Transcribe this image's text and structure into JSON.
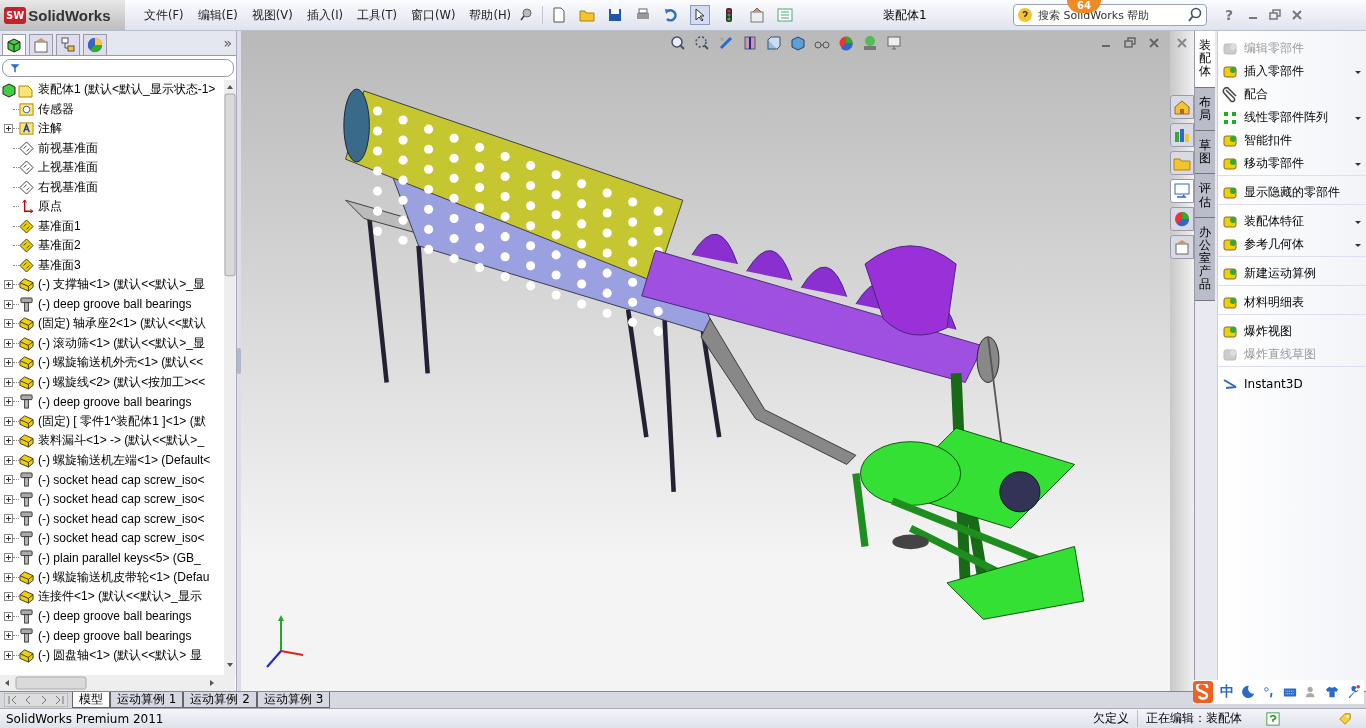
{
  "app": {
    "logo_mark": "SW",
    "logo_text": "SolidWorks"
  },
  "menu": [
    "文件(F)",
    "编辑(E)",
    "视图(V)",
    "插入(I)",
    "工具(T)",
    "窗口(W)",
    "帮助(H)"
  ],
  "window": {
    "title": "装配体1"
  },
  "search": {
    "placeholder": "搜索 SolidWorks 帮助",
    "badge": "64"
  },
  "help_button": "?",
  "panel_expand": "»",
  "tree": {
    "label": "装配体1  (默认<默认_显示状态-1>",
    "kind": "assembly",
    "children": [
      {
        "label": "传感器",
        "kind": "sensor",
        "expander": false
      },
      {
        "label": "注解",
        "kind": "annotation",
        "expander": true
      },
      {
        "label": "前视基准面",
        "kind": "plane",
        "expander": false
      },
      {
        "label": "上视基准面",
        "kind": "plane",
        "expander": false
      },
      {
        "label": "右视基准面",
        "kind": "plane",
        "expander": false
      },
      {
        "label": "原点",
        "kind": "origin",
        "expander": false
      },
      {
        "label": "基准面1",
        "kind": "ref-plane",
        "expander": false
      },
      {
        "label": "基准面2",
        "kind": "ref-plane",
        "expander": false
      },
      {
        "label": "基准面3",
        "kind": "ref-plane",
        "expander": false
      },
      {
        "label": "(-) 支撑轴<1> (默认<<默认>_显",
        "kind": "part",
        "expander": true
      },
      {
        "label": "(-) deep groove ball bearings",
        "kind": "fastener",
        "expander": true
      },
      {
        "label": "(固定) 轴承座2<1> (默认<<默认",
        "kind": "part",
        "expander": true
      },
      {
        "label": "(-) 滚动筛<1> (默认<<默认>_显",
        "kind": "part",
        "expander": true
      },
      {
        "label": "(-) 螺旋输送机外壳<1> (默认<<",
        "kind": "part",
        "expander": true
      },
      {
        "label": "(-) 螺旋线<2> (默认<按加工><<",
        "kind": "part",
        "expander": true
      },
      {
        "label": "(-) deep groove ball bearings",
        "kind": "fastener",
        "expander": true
      },
      {
        "label": "(固定) [ 零件1^装配体1 ]<1> (默",
        "kind": "part",
        "expander": true
      },
      {
        "label": "装料漏斗<1> -> (默认<<默认>_",
        "kind": "part",
        "expander": true
      },
      {
        "label": "(-) 螺旋输送机左端<1> (Default<",
        "kind": "part",
        "expander": true
      },
      {
        "label": "(-) socket head cap screw_iso<",
        "kind": "fastener",
        "expander": true
      },
      {
        "label": "(-) socket head cap screw_iso<",
        "kind": "fastener",
        "expander": true
      },
      {
        "label": "(-) socket head cap screw_iso<",
        "kind": "fastener",
        "expander": true
      },
      {
        "label": "(-) socket head cap screw_iso<",
        "kind": "fastener",
        "expander": true
      },
      {
        "label": "(-) plain parallel keys<5> (GB_",
        "kind": "fastener",
        "expander": true
      },
      {
        "label": "(-) 螺旋输送机皮带轮<1> (Defau",
        "kind": "part",
        "expander": true
      },
      {
        "label": "连接件<1> (默认<<默认>_显示",
        "kind": "part",
        "expander": true
      },
      {
        "label": "(-) deep groove ball bearings",
        "kind": "fastener",
        "expander": true
      },
      {
        "label": "(-) deep groove ball bearings",
        "kind": "fastener",
        "expander": true
      },
      {
        "label": "(-) 圆盘轴<1> (默认<<默认> 显",
        "kind": "part",
        "expander": true
      }
    ]
  },
  "bottom_tabs": [
    {
      "label": "模型",
      "selected": true
    },
    {
      "label": "运动算例 1",
      "selected": false
    },
    {
      "label": "运动算例 2",
      "selected": false
    },
    {
      "label": "运动算例 3",
      "selected": false
    }
  ],
  "task_tabs": [
    {
      "label": "装配体",
      "selected": true
    },
    {
      "label": "布局",
      "selected": false
    },
    {
      "label": "草图",
      "selected": false
    },
    {
      "label": "评估",
      "selected": false
    },
    {
      "label": "办公室产品",
      "selected": false
    }
  ],
  "commands": [
    {
      "label": "编辑零部件",
      "kind": "edit-component",
      "disabled": true,
      "dropdown": false,
      "divider": false
    },
    {
      "label": "插入零部件",
      "kind": "insert",
      "disabled": false,
      "dropdown": true,
      "divider": false
    },
    {
      "label": "配合",
      "kind": "mate",
      "disabled": false,
      "dropdown": false,
      "divider": false
    },
    {
      "label": "线性零部件阵列",
      "kind": "pattern",
      "disabled": false,
      "dropdown": true,
      "divider": false
    },
    {
      "label": "智能扣件",
      "kind": "fastener",
      "disabled": false,
      "dropdown": false,
      "divider": false
    },
    {
      "label": "移动零部件",
      "kind": "move",
      "disabled": false,
      "dropdown": true,
      "divider": true
    },
    {
      "label": "显示隐藏的零部件",
      "kind": "show-hidden",
      "disabled": false,
      "dropdown": false,
      "divider": true
    },
    {
      "label": "装配体特征",
      "kind": "feature",
      "disabled": false,
      "dropdown": true,
      "divider": false
    },
    {
      "label": "参考几何体",
      "kind": "reference",
      "disabled": false,
      "dropdown": true,
      "divider": true
    },
    {
      "label": "新建运动算例",
      "kind": "motion",
      "disabled": false,
      "dropdown": false,
      "divider": true
    },
    {
      "label": "材料明细表",
      "kind": "bom",
      "disabled": false,
      "dropdown": false,
      "divider": true
    },
    {
      "label": "爆炸视图",
      "kind": "explode",
      "disabled": false,
      "dropdown": false,
      "divider": false
    },
    {
      "label": "爆炸直线草图",
      "kind": "explode-line",
      "disabled": true,
      "dropdown": false,
      "divider": true
    },
    {
      "label": "Instant3D",
      "kind": "instant3d",
      "disabled": false,
      "dropdown": false,
      "divider": false
    }
  ],
  "ime": {
    "mode": "中"
  },
  "status_bar": {
    "product": "SolidWorks Premium 2011",
    "state": "欠定义",
    "editing": "正在编辑：装配体"
  }
}
